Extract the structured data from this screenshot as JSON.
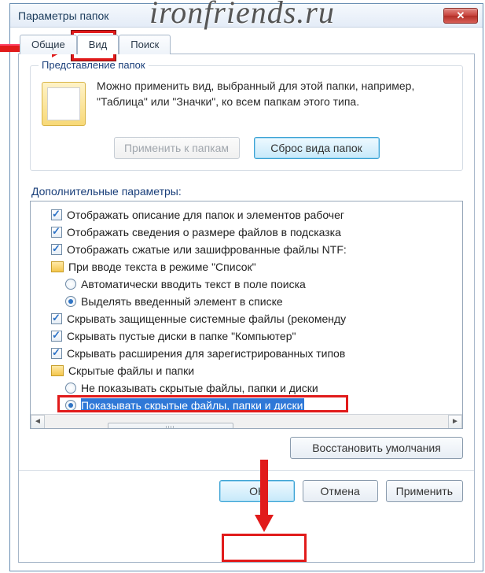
{
  "watermark": "ironfriends.ru",
  "title": "Параметры папок",
  "close_x": "✕",
  "tabs": {
    "general": "Общие",
    "view": "Вид",
    "search": "Поиск"
  },
  "group": {
    "title": "Представление папок",
    "desc": "Можно применить вид, выбранный для этой папки, например, \"Таблица\" или \"Значки\", ко всем папкам этого типа.",
    "apply": "Применить к папкам",
    "reset": "Сброс вида папок"
  },
  "adv_label": "Дополнительные параметры:",
  "tree": {
    "r1": "Отображать описание для папок и элементов рабочег",
    "r2": "Отображать сведения о размере файлов в подсказка",
    "r3": "Отображать сжатые или зашифрованные файлы NTF:",
    "r4": "При вводе текста в режиме \"Список\"",
    "r5": "Автоматически вводить текст в поле поиска",
    "r6": "Выделять введенный элемент в списке",
    "r7": "Скрывать защищенные системные файлы (рекоменду",
    "r8": "Скрывать пустые диски в папке \"Компьютер\"",
    "r9": "Скрывать расширения для зарегистрированных типов",
    "r10": "Скрытые файлы и папки",
    "r11": "Не показывать скрытые файлы, папки и диски",
    "r12": "Показывать скрытые файлы, папки и диски"
  },
  "restore": "Восстановить умолчания",
  "footer": {
    "ok": "ОК",
    "cancel": "Отмена",
    "apply": "Применить"
  }
}
